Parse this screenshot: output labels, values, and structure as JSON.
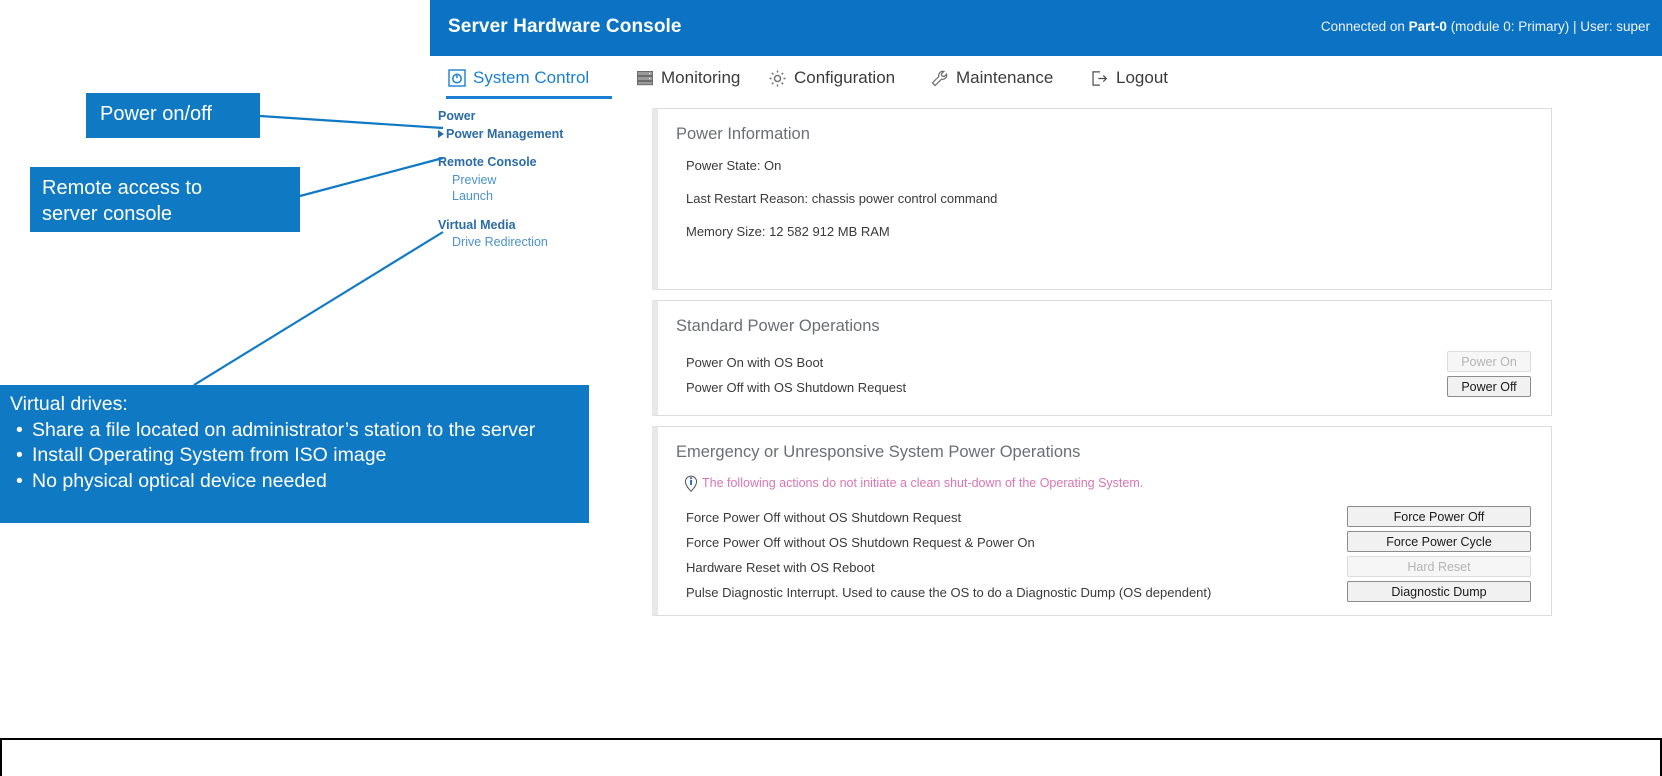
{
  "app": {
    "header": {
      "title": "Server Hardware Console",
      "connection_prefix": "Connected on ",
      "connection_target": "Part-0",
      "connection_suffix": " (module 0: Primary)  |  User: super"
    },
    "nav": [
      {
        "label": "System Control",
        "icon": "power-icon",
        "active": true
      },
      {
        "label": "Monitoring",
        "icon": "server-rack-icon",
        "active": false
      },
      {
        "label": "Configuration",
        "icon": "gear-icon",
        "active": false
      },
      {
        "label": "Maintenance",
        "icon": "wrench-icon",
        "active": false
      },
      {
        "label": "Logout",
        "icon": "logout-icon",
        "active": false
      }
    ],
    "tree": [
      {
        "head": "Power",
        "items": [
          {
            "label": "Power Management",
            "selected": true
          }
        ]
      },
      {
        "head": "Remote Console",
        "items": [
          {
            "label": "Preview",
            "selected": false
          },
          {
            "label": "Launch",
            "selected": false
          }
        ]
      },
      {
        "head": "Virtual Media",
        "items": [
          {
            "label": "Drive Redirection",
            "selected": false
          }
        ]
      }
    ],
    "panels": {
      "power_information": {
        "title": "Power Information",
        "lines": [
          "Power State: On",
          "Last Restart Reason: chassis power control command",
          "Memory Size:  12 582 912 MB RAM"
        ]
      },
      "standard_power": {
        "title": "Standard Power Operations",
        "rows": [
          {
            "label": "Power On with OS Boot",
            "button": "Power On",
            "disabled": true
          },
          {
            "label": "Power Off with OS Shutdown Request",
            "button": "Power Off",
            "disabled": false
          }
        ]
      },
      "emergency_power": {
        "title": "Emergency or Unresponsive System Power Operations",
        "warning": "The following actions do not initiate a clean shut-down of the Operating System.",
        "warning_color": "#d976b2",
        "rows": [
          {
            "label": "Force Power Off without OS Shutdown Request",
            "button": "Force Power Off",
            "disabled": false
          },
          {
            "label": "Force Power Off without OS Shutdown Request & Power On",
            "button": "Force Power Cycle",
            "disabled": false
          },
          {
            "label": "Hardware Reset with OS Reboot",
            "button": "Hard Reset",
            "disabled": true
          },
          {
            "label": "Pulse Diagnostic Interrupt. Used to cause the OS to do a Diagnostic Dump (OS dependent)",
            "button": "Diagnostic Dump",
            "disabled": false
          }
        ]
      }
    }
  },
  "annotations": {
    "accent_color": "#1079c4",
    "power": {
      "text": "Power on/off"
    },
    "remote": {
      "line1": "Remote access to",
      "line2": "server console"
    },
    "virtual": {
      "title": "Virtual drives:",
      "bullets": [
        "Share a file located on administrator’s station to the server",
        "Install Operating System from ISO image",
        "No physical optical device needed"
      ]
    }
  }
}
